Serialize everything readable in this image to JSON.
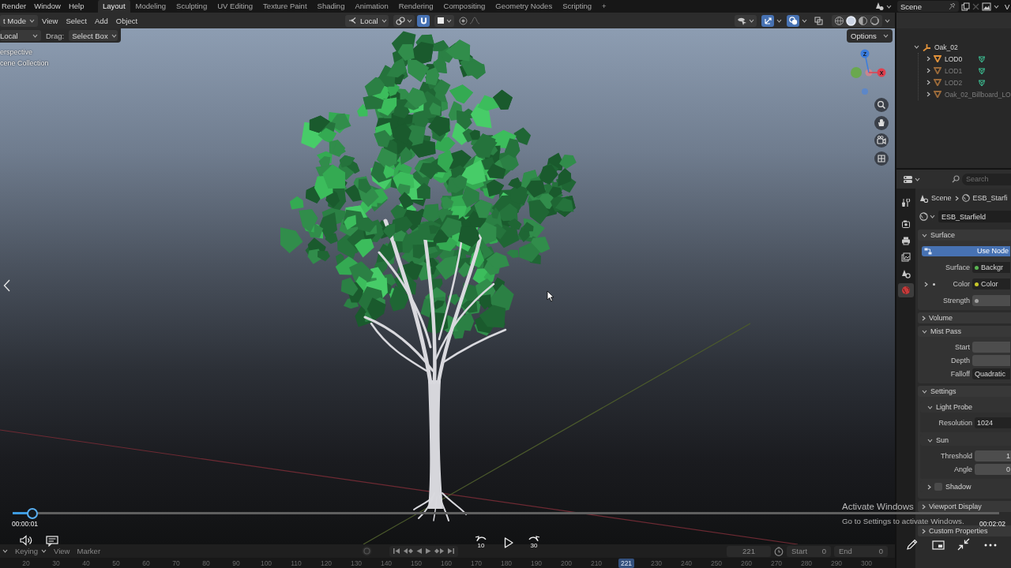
{
  "top_bar": {
    "menus": [
      "Render",
      "Window",
      "Help"
    ],
    "workspaces": [
      {
        "label": "Layout",
        "selected": true
      },
      {
        "label": "Modeling",
        "selected": false
      },
      {
        "label": "Sculpting",
        "selected": false
      },
      {
        "label": "UV Editing",
        "selected": false
      },
      {
        "label": "Texture Paint",
        "selected": false
      },
      {
        "label": "Shading",
        "selected": false
      },
      {
        "label": "Animation",
        "selected": false
      },
      {
        "label": "Rendering",
        "selected": false
      },
      {
        "label": "Compositing",
        "selected": false
      },
      {
        "label": "Geometry Nodes",
        "selected": false
      },
      {
        "label": "Scripting",
        "selected": false
      }
    ],
    "add_workspace": "+",
    "scene": "Scene",
    "view_layer": "V"
  },
  "viewport_header": {
    "mode": "t Mode",
    "menus": [
      "View",
      "Select",
      "Add",
      "Object"
    ],
    "orientation": "Local",
    "toggles": [
      {
        "kind": "snap",
        "on": true
      },
      {
        "kind": "proportional",
        "on": false
      },
      {
        "kind": "gizmos",
        "on": true
      },
      {
        "kind": "overlays",
        "on": true
      },
      {
        "kind": "xray",
        "on": false
      }
    ],
    "shading": [
      {
        "kind": "wireframe",
        "selected": false
      },
      {
        "kind": "solid",
        "selected": true
      },
      {
        "kind": "material",
        "selected": false
      },
      {
        "kind": "rendered",
        "selected": false
      }
    ]
  },
  "tool_settings": {
    "orientation": "Local",
    "drag_label": "Drag:",
    "drag": "Select Box"
  },
  "viewport": {
    "options": "Options",
    "info": [
      "erspective",
      "cene Collection"
    ],
    "gizmo_axes": [
      {
        "label": "Z",
        "color": "#3b7ddd"
      },
      {
        "label": "X",
        "color": "#e0404f"
      }
    ]
  },
  "outliner": {
    "items": [
      {
        "label": "Oak_02",
        "kind": "empty",
        "expanded": true,
        "hidden": false,
        "mesh_data": false,
        "children": [
          {
            "label": "LOD0",
            "kind": "mesh",
            "expanded": false,
            "hidden": false,
            "mesh_data": true
          },
          {
            "label": "LOD1",
            "kind": "mesh",
            "expanded": false,
            "hidden": true,
            "mesh_data": true
          },
          {
            "label": "LOD2",
            "kind": "mesh",
            "expanded": false,
            "hidden": true,
            "mesh_data": true
          },
          {
            "label": "Oak_02_Billboard_LO",
            "kind": "mesh",
            "expanded": false,
            "hidden": true,
            "mesh_data": false
          }
        ]
      }
    ]
  },
  "properties": {
    "search": {
      "placeholder": "Search"
    },
    "tabs": [
      {
        "kind": "tool",
        "selected": false
      },
      {
        "kind": "render",
        "selected": false
      },
      {
        "kind": "output",
        "selected": false
      },
      {
        "kind": "view_layer",
        "selected": false
      },
      {
        "kind": "scene",
        "selected": false
      },
      {
        "kind": "world",
        "selected": true
      }
    ],
    "breadcrumb": [
      "Scene",
      "ESB_Starfi"
    ],
    "world": "ESB_Starfield",
    "panels": [
      {
        "title": "Surface",
        "expanded": true,
        "rows": [
          {
            "kind": "button",
            "label": "Use Node"
          },
          {
            "kind": "socket",
            "label": "Surface",
            "value": "Backgr",
            "color": "#5ab552"
          },
          {
            "kind": "socket",
            "label": "Color",
            "value": "Color",
            "color": "#c7c729",
            "expanded": false
          },
          {
            "kind": "socket",
            "label": "Strength",
            "color": "#a1a1a1"
          }
        ]
      },
      {
        "title": "Volume",
        "expanded": false
      },
      {
        "title": "Mist Pass",
        "expanded": true,
        "rows": [
          {
            "kind": "number",
            "label": "Start"
          },
          {
            "kind": "number",
            "label": "Depth"
          },
          {
            "kind": "dropdown",
            "label": "Falloff",
            "value": "Quadratic"
          }
        ]
      },
      {
        "title": "Settings",
        "expanded": true,
        "children": [
          {
            "title": "Light Probe",
            "expanded": true,
            "rows": [
              {
                "kind": "dropdown",
                "label": "Resolution",
                "value": "1024"
              }
            ]
          },
          {
            "title": "Sun",
            "expanded": true,
            "rows": [
              {
                "kind": "number",
                "label": "Threshold",
                "value": "1"
              },
              {
                "kind": "number",
                "label": "Angle",
                "value": "0"
              }
            ]
          },
          {
            "title": "Shadow",
            "expanded": false,
            "checked": false
          }
        ]
      },
      {
        "title": "Viewport Display",
        "expanded": false
      },
      {
        "title": "Custom Properties",
        "expanded": false
      }
    ]
  },
  "timeline": {
    "menus": [
      {
        "label": "Keying",
        "dropdown": true
      },
      {
        "label": "View",
        "dropdown": false
      },
      {
        "label": "Marker",
        "dropdown": false
      }
    ],
    "current_frame": "221",
    "start_label": "Start",
    "start": "0",
    "end_label": "End",
    "end": "0",
    "ruler": [
      {
        "label": "20",
        "selected": false
      },
      {
        "label": "30",
        "selected": false
      },
      {
        "label": "40",
        "selected": false
      },
      {
        "label": "50",
        "selected": false
      },
      {
        "label": "60",
        "selected": false
      },
      {
        "label": "70",
        "selected": false
      },
      {
        "label": "80",
        "selected": false
      },
      {
        "label": "90",
        "selected": false
      },
      {
        "label": "100",
        "selected": false
      },
      {
        "label": "110",
        "selected": false
      },
      {
        "label": "120",
        "selected": false
      },
      {
        "label": "130",
        "selected": false
      },
      {
        "label": "140",
        "selected": false
      },
      {
        "label": "150",
        "selected": false
      },
      {
        "label": "160",
        "selected": false
      },
      {
        "label": "170",
        "selected": false
      },
      {
        "label": "180",
        "selected": false
      },
      {
        "label": "190",
        "selected": false
      },
      {
        "label": "200",
        "selected": false
      },
      {
        "label": "210",
        "selected": false
      },
      {
        "label": "221",
        "selected": true
      },
      {
        "label": "230",
        "selected": false
      },
      {
        "label": "240",
        "selected": false
      },
      {
        "label": "250",
        "selected": false
      },
      {
        "label": "260",
        "selected": false
      },
      {
        "label": "270",
        "selected": false
      },
      {
        "label": "280",
        "selected": false
      },
      {
        "label": "290",
        "selected": false
      },
      {
        "label": "300",
        "selected": false
      }
    ]
  },
  "player": {
    "level": 0.02,
    "elapsed": "00:00:01",
    "duration": "00:02:02",
    "rewind": "10",
    "forward": "30"
  },
  "os_notice": {
    "title": "Activate Windows",
    "body": "Go to Settings to activate Windows."
  }
}
